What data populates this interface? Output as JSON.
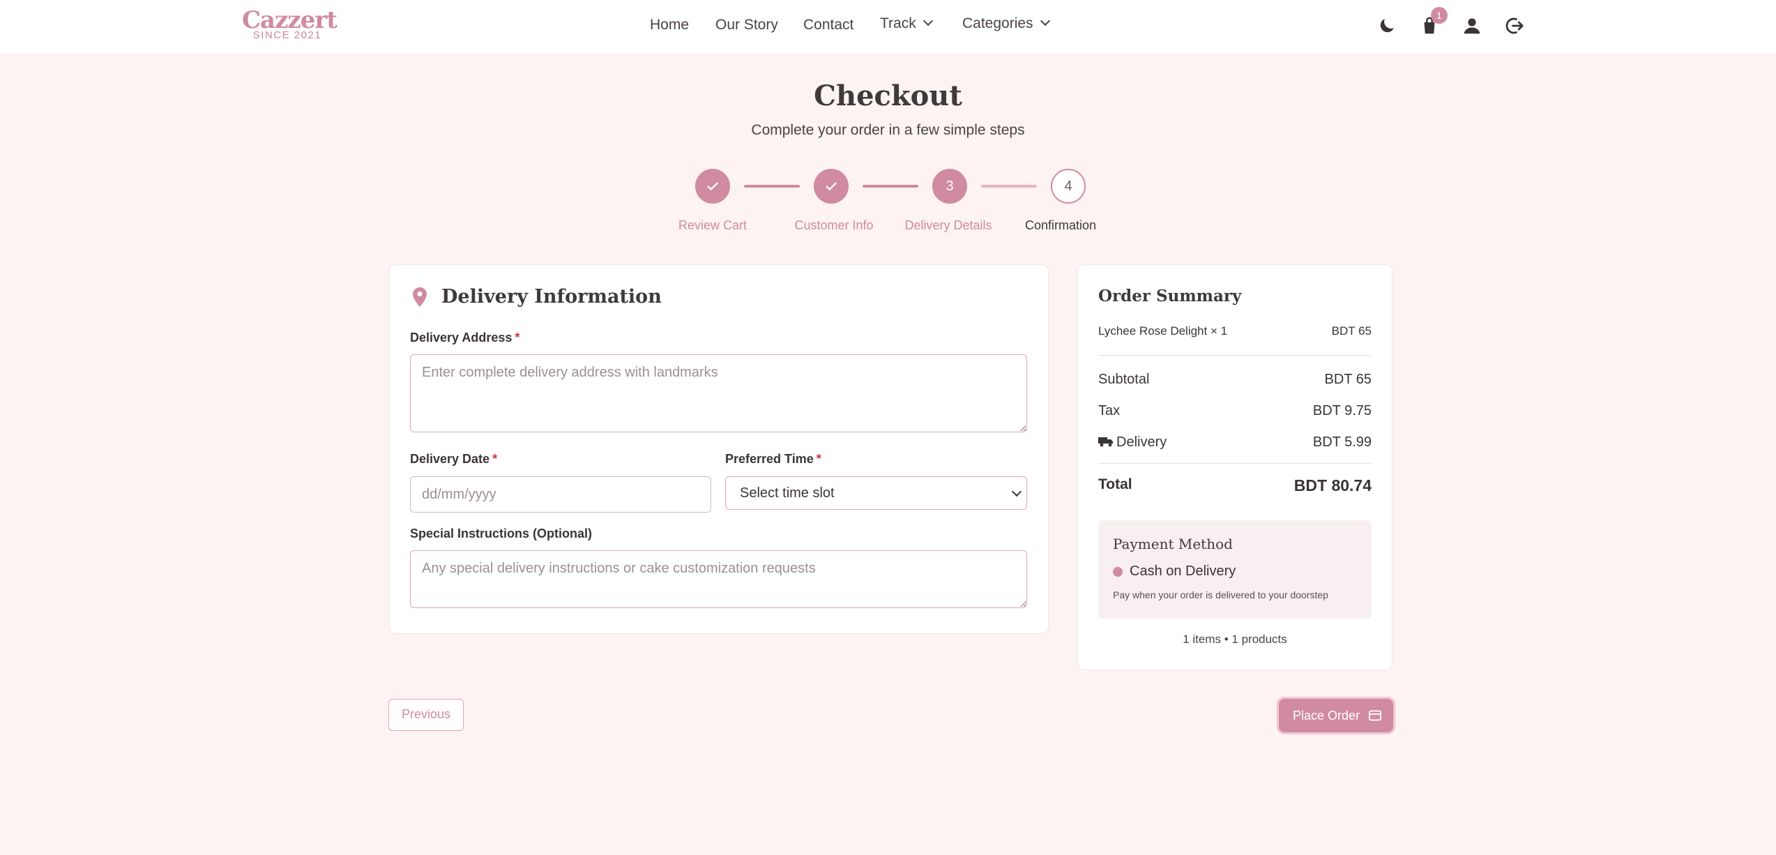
{
  "brand": {
    "name": "Cazzert",
    "tagline": "SINCE 2021"
  },
  "nav": {
    "links": [
      "Home",
      "Our Story",
      "Contact",
      "Track",
      "Categories"
    ],
    "cart_count": "1",
    "icons": [
      "moon-icon",
      "shopping-bag-icon",
      "user-icon",
      "logout-icon"
    ]
  },
  "page": {
    "title": "Checkout",
    "subtitle": "Complete your order in a few simple steps"
  },
  "steps": [
    {
      "label": "Review Cart",
      "state": "done",
      "marker": "✓"
    },
    {
      "label": "Customer Info",
      "state": "done",
      "marker": "✓"
    },
    {
      "label": "Delivery Details",
      "state": "active",
      "marker": "3"
    },
    {
      "label": "Confirmation",
      "state": "pending",
      "marker": "4"
    }
  ],
  "delivery": {
    "title": "Delivery Information",
    "address_label": "Delivery Address",
    "address_placeholder": "Enter complete delivery address with landmarks",
    "date_label": "Delivery Date",
    "date_placeholder": "dd/mm/yyyy",
    "time_label": "Preferred Time",
    "time_selected": "Select time slot",
    "instructions_label": "Special Instructions (Optional)",
    "instructions_placeholder": "Any special delivery instructions or cake customization requests",
    "required_mark": "*"
  },
  "summary": {
    "title": "Order Summary",
    "item_name": "Lychee Rose Delight × 1",
    "item_price": "BDT 65",
    "subtotal_label": "Subtotal",
    "subtotal_value": "BDT 65",
    "tax_label": "Tax",
    "tax_value": "BDT 9.75",
    "delivery_label": "Delivery",
    "delivery_value": "BDT 5.99",
    "total_label": "Total",
    "total_value": "BDT 80.74",
    "payment_title": "Payment Method",
    "payment_option": "Cash on Delivery",
    "payment_note": "Pay when your order is delivered to your doorstep",
    "counts": "1 items • 1 products"
  },
  "actions": {
    "previous": "Previous",
    "place_order": "Place Order"
  },
  "colors": {
    "accent": "#d08aa1",
    "background": "#fdf3f2",
    "text": "#3a3436"
  }
}
